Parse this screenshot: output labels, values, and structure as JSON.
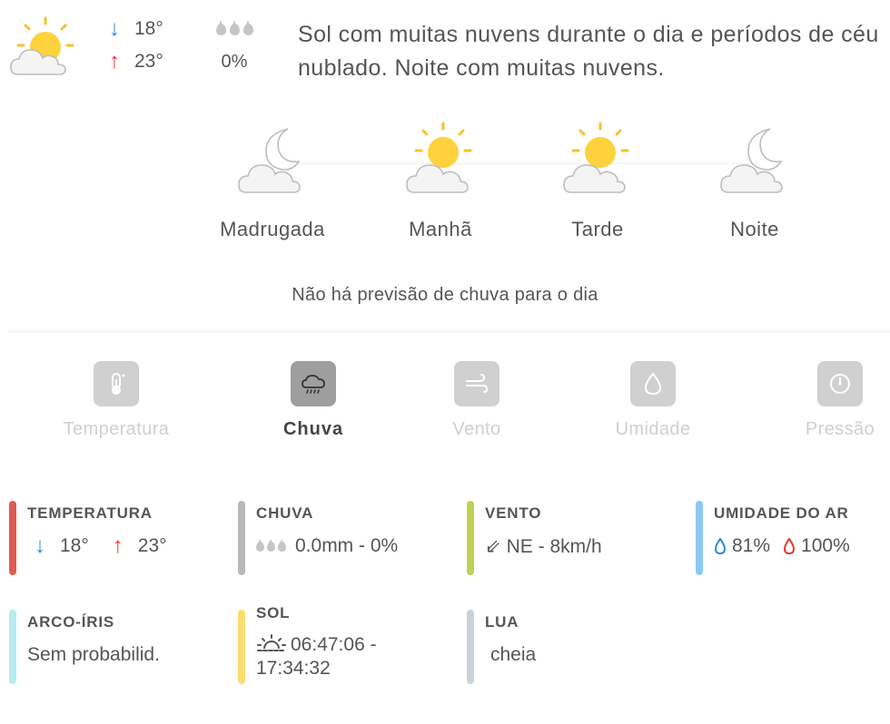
{
  "summary": {
    "icon": "sun-cloud-icon",
    "temp_min": "18°",
    "temp_max": "23°",
    "rain_probability": "0%",
    "description": "Sol com muitas nuvens durante o dia e períodos de céu nublado. Noite com muitas nuvens."
  },
  "periods": [
    {
      "label": "Madrugada",
      "icon": "moon-cloud-icon"
    },
    {
      "label": "Manhã",
      "icon": "sun-cloud-icon"
    },
    {
      "label": "Tarde",
      "icon": "sun-cloud-icon"
    },
    {
      "label": "Noite",
      "icon": "moon-cloud-icon"
    }
  ],
  "no_rain_text": "Não há previsão de chuva para o dia",
  "tabs": [
    {
      "label": "Temperatura",
      "icon": "thermometer-icon",
      "active": false
    },
    {
      "label": "Chuva",
      "icon": "rain-cloud-icon",
      "active": true
    },
    {
      "label": "Vento",
      "icon": "wind-icon",
      "active": false
    },
    {
      "label": "Umidade",
      "icon": "drop-icon",
      "active": false
    },
    {
      "label": "Pressão",
      "icon": "gauge-icon",
      "active": false
    }
  ],
  "cards": {
    "temperatura": {
      "title": "TEMPERATURA",
      "min": "18°",
      "max": "23°",
      "color": "#e05a52"
    },
    "chuva": {
      "title": "CHUVA",
      "value": "0.0mm - 0%",
      "color": "#b8b8b8"
    },
    "vento": {
      "title": "VENTO",
      "arrow": "⇙",
      "value": "NE - 8km/h",
      "color": "#bfd052"
    },
    "umidade": {
      "title": "UMIDADE DO AR",
      "min": "81%",
      "max": "100%",
      "color": "#8cc8f5"
    },
    "arco_iris": {
      "title": "ARCO-ÍRIS",
      "value": "Sem probabilid.",
      "color": "#b4ecf0"
    },
    "sol": {
      "title": "SOL",
      "value": "06:47:06 - 17:34:32",
      "color": "#fbdc6e"
    },
    "lua": {
      "title": "LUA",
      "value": "cheia",
      "color": "#c9d2da"
    }
  },
  "colors": {
    "arrow_down": "#2b8ad6",
    "arrow_up": "#e53935",
    "sun": "#fdd23d",
    "cloud_stroke": "#bdbdbd"
  }
}
